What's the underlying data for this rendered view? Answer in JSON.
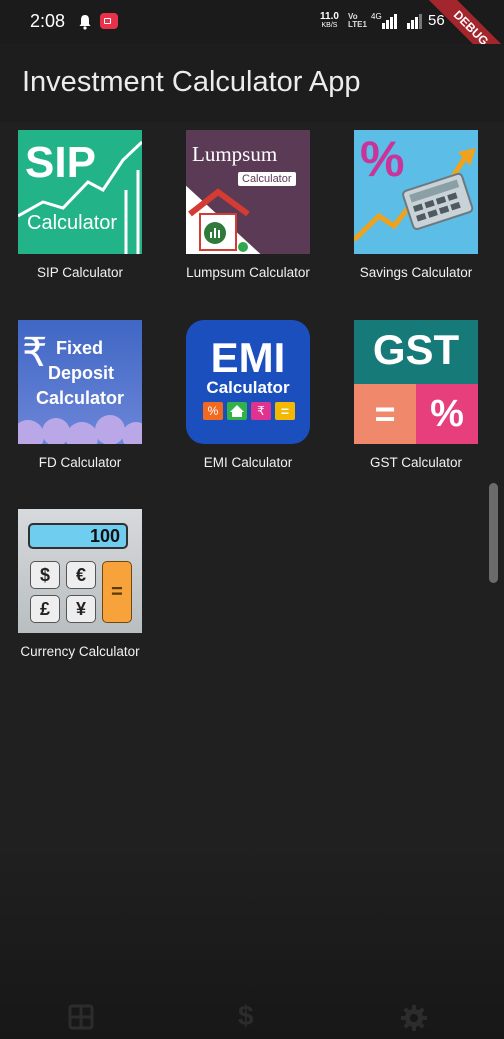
{
  "status_bar": {
    "time": "2:08",
    "speed_value": "11.0",
    "speed_unit": "KB/S",
    "volte_top": "Vo",
    "volte_bottom": "LTE1",
    "network_type": "4G",
    "battery": "56",
    "debug_banner": "DEBUG",
    "icons": [
      "bell-icon",
      "screen-record-icon",
      "signal-icon",
      "battery-icon"
    ]
  },
  "app_bar": {
    "title": "Investment Calculator App"
  },
  "calculators": [
    {
      "label": "SIP Calculator",
      "icon": "sip-calculator-icon",
      "icon_text_1": "SIP",
      "icon_text_2": "Calculator"
    },
    {
      "label": "Lumpsum Calculator",
      "icon": "lumpsum-calculator-icon",
      "icon_text_1": "Lumpsum",
      "icon_text_2": "Calculator"
    },
    {
      "label": "Savings Calculator",
      "icon": "savings-calculator-icon",
      "icon_text_1": "%"
    },
    {
      "label": "FD Calculator",
      "icon": "fd-calculator-icon",
      "icon_text_1": "₹",
      "icon_text_2": "Fixed",
      "icon_text_3": "Deposit",
      "icon_text_4": "Calculator"
    },
    {
      "label": "EMI Calculator",
      "icon": "emi-calculator-icon",
      "icon_text_1": "EMI",
      "icon_text_2": "Calculator",
      "icon_text_3": "%",
      "icon_text_4": "₹",
      "icon_text_5": "="
    },
    {
      "label": "GST Calculator",
      "icon": "gst-calculator-icon",
      "icon_text_1": "GST",
      "icon_text_2": "=",
      "icon_text_3": "%"
    },
    {
      "label": "Currency Calculator",
      "icon": "currency-calculator-icon",
      "icon_text_1": "100",
      "icon_text_2": "$",
      "icon_text_3": "€",
      "icon_text_4": "£",
      "icon_text_5": "¥",
      "icon_text_6": "="
    }
  ],
  "bottom_nav": {
    "dollar_glyph": "$",
    "items": [
      "calculator-icon",
      "dollar-icon",
      "settings-icon"
    ]
  },
  "colors": {
    "background": "#202020",
    "app_bar": "#1d1d1d",
    "sip": "#22b488",
    "lumpsum": "#5a3a55",
    "savings": "#5cbde6",
    "fd": "#4a73c9",
    "emi": "#1a4fbd",
    "gst_top": "#167a78",
    "gst_left": "#f0886c",
    "gst_right": "#e73f7c",
    "debug": "#a3262d"
  }
}
